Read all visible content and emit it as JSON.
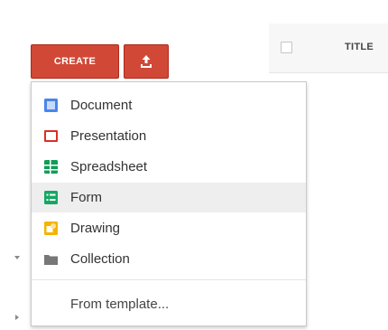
{
  "toolbar": {
    "create_label": "CREATE",
    "upload_icon": "upload-icon"
  },
  "list_header": {
    "title_label": "TITLE",
    "checkbox_checked": false
  },
  "menu": {
    "items": [
      {
        "label": "Document",
        "icon": "document-icon",
        "color": "#4a86e8"
      },
      {
        "label": "Presentation",
        "icon": "presentation-icon",
        "color": "#d93025"
      },
      {
        "label": "Spreadsheet",
        "icon": "spreadsheet-icon",
        "color": "#0f9d58"
      },
      {
        "label": "Form",
        "icon": "form-icon",
        "color": "#16a765",
        "highlighted": true
      },
      {
        "label": "Drawing",
        "icon": "drawing-icon",
        "color": "#f4b400"
      },
      {
        "label": "Collection",
        "icon": "folder-icon",
        "color": "#777777"
      }
    ],
    "template_label": "From template..."
  },
  "colors": {
    "accent": "#d14836",
    "menu_highlight": "#eeeeee"
  }
}
